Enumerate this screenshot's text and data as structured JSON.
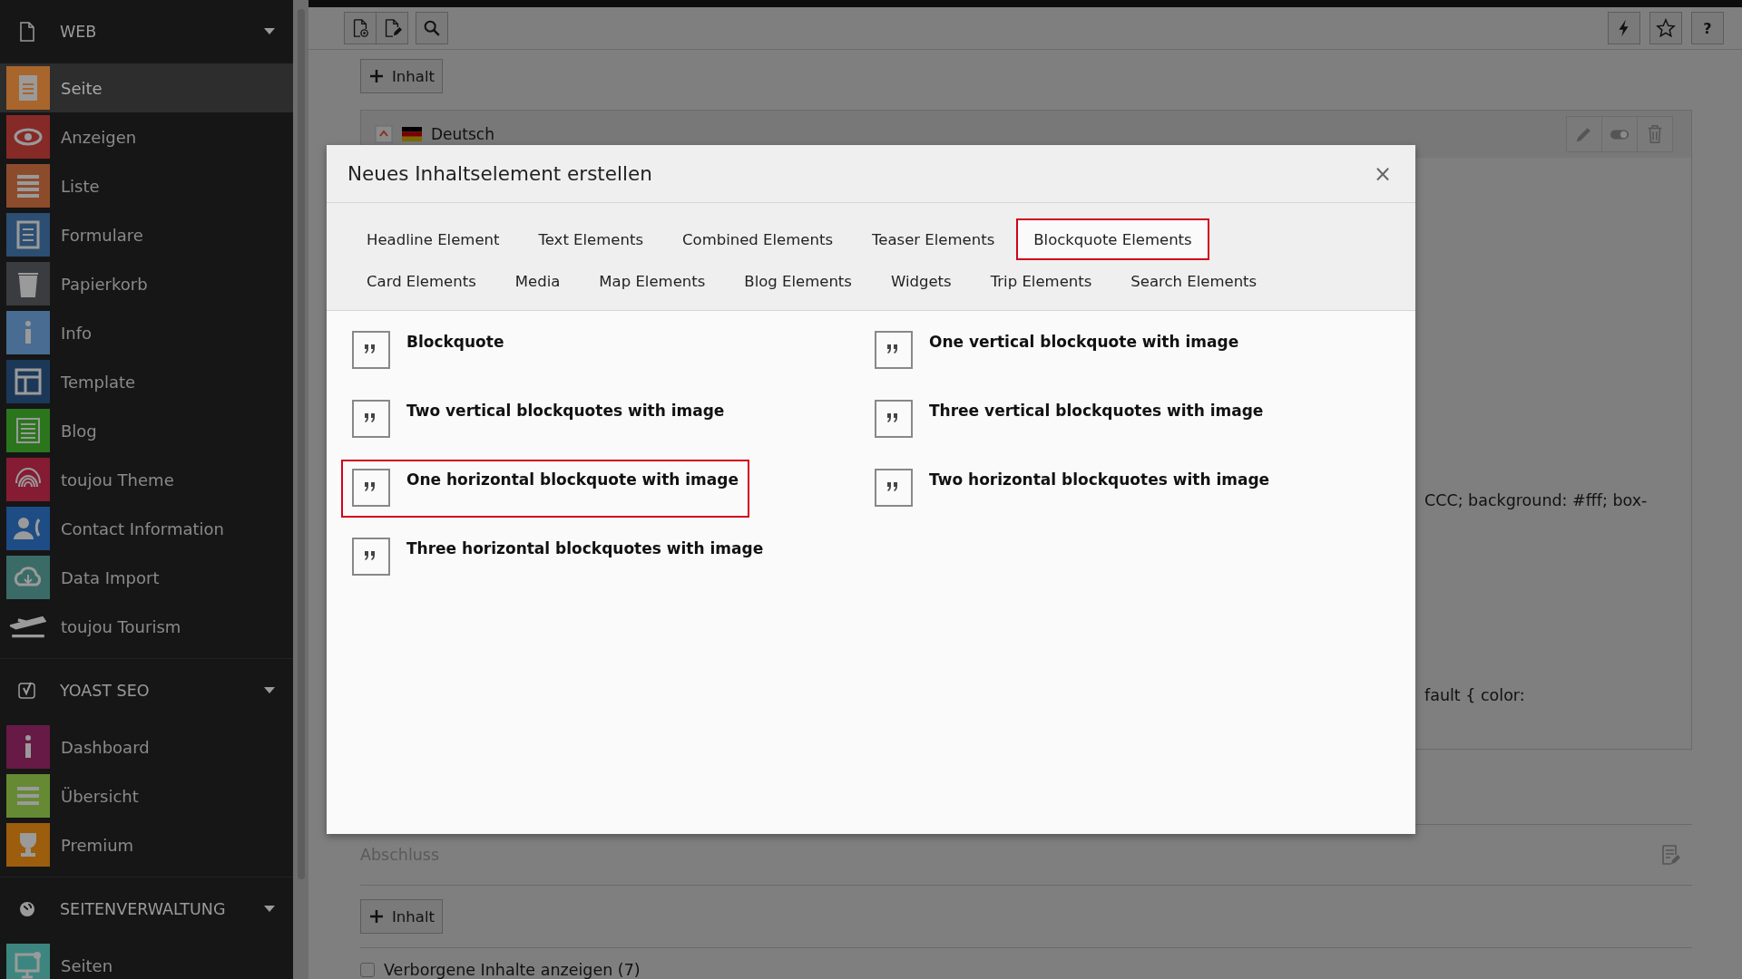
{
  "sidebar": {
    "groups": [
      {
        "title": "WEB",
        "expanded": true,
        "items": [
          {
            "label": "Seite",
            "selected": true,
            "color": "#a8652c"
          },
          {
            "label": "Anzeigen",
            "selected": false,
            "color": "#862a27"
          },
          {
            "label": "Liste",
            "selected": false,
            "color": "#8c4c2c"
          },
          {
            "label": "Formulare",
            "selected": false,
            "color": "#2b4e72"
          },
          {
            "label": "Papierkorb",
            "selected": false,
            "color": "#3a3c3f"
          },
          {
            "label": "Info",
            "selected": false,
            "color": "#486c92"
          },
          {
            "label": "Template",
            "selected": false,
            "color": "#1c3859"
          },
          {
            "label": "Blog",
            "selected": false,
            "color": "#2b761d"
          },
          {
            "label": "toujou Theme",
            "selected": false,
            "color": "#851c33"
          },
          {
            "label": "Contact Information",
            "selected": false,
            "color": "#1e4c85"
          },
          {
            "label": "Data Import",
            "selected": false,
            "color": "#3a6b67"
          },
          {
            "label": "toujou Tourism",
            "selected": false
          }
        ]
      },
      {
        "title": "YOAST SEO",
        "expanded": true,
        "items": [
          {
            "label": "Dashboard",
            "selected": false,
            "color": "#661a45"
          },
          {
            "label": "Übersicht",
            "selected": false,
            "color": "#668a33"
          },
          {
            "label": "Premium",
            "selected": false,
            "color": "#9c5d0c"
          }
        ]
      },
      {
        "title": "SEITENVERWALTUNG",
        "expanded": true,
        "items": [
          {
            "label": "Seiten",
            "selected": false,
            "color": "#3d8680"
          }
        ]
      }
    ]
  },
  "toolbar": {
    "help": "?"
  },
  "page": {
    "add_button": "Inhalt",
    "language": "Deutsch",
    "code_lines": [
      "CCC; background: #fff; box-",
      "fault { color:"
    ],
    "footer_section": "Abschluss",
    "add_button_2": "Inhalt",
    "hidden_toggle": {
      "label": "Verborgene Inhalte anzeigen (7)",
      "checked": false
    }
  },
  "modal": {
    "title": "Neues Inhaltselement erstellen",
    "close": "×",
    "tabs": [
      {
        "label": "Headline Element",
        "selected": false
      },
      {
        "label": "Text Elements",
        "selected": false
      },
      {
        "label": "Combined Elements",
        "selected": false
      },
      {
        "label": "Teaser Elements",
        "selected": false
      },
      {
        "label": "Blockquote Elements",
        "selected": true
      },
      {
        "label": "Card Elements",
        "selected": false
      },
      {
        "label": "Media",
        "selected": false
      },
      {
        "label": "Map Elements",
        "selected": false
      },
      {
        "label": "Blog Elements",
        "selected": false
      },
      {
        "label": "Widgets",
        "selected": false
      },
      {
        "label": "Trip Elements",
        "selected": false
      },
      {
        "label": "Search Elements",
        "selected": false
      }
    ],
    "elements": [
      {
        "label": "Blockquote",
        "selected": false
      },
      {
        "label": "One vertical blockquote with image",
        "selected": false
      },
      {
        "label": "Two vertical blockquotes with image",
        "selected": false
      },
      {
        "label": "Three vertical blockquotes with image",
        "selected": false
      },
      {
        "label": "One horizontal blockquote with image",
        "selected": true
      },
      {
        "label": "Two horizontal blockquotes with image",
        "selected": false
      },
      {
        "label": "Three horizontal blockquotes with image",
        "selected": false
      }
    ]
  }
}
